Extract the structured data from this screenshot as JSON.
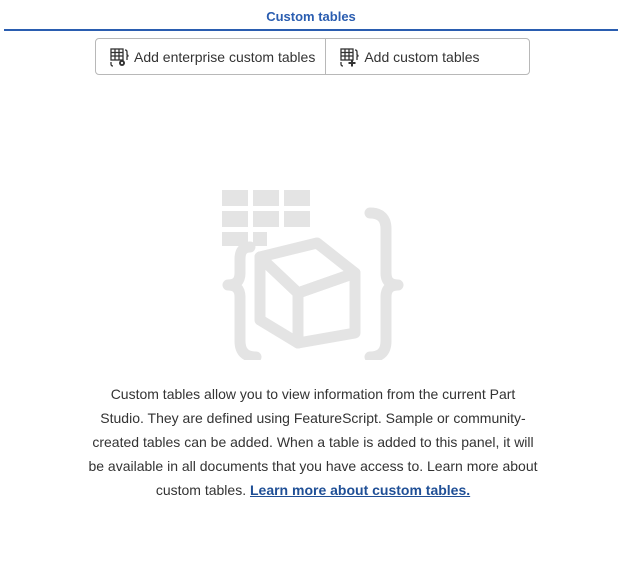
{
  "header": {
    "title": "Custom tables"
  },
  "toolbar": {
    "add_enterprise_label": "Add enterprise custom tables",
    "add_custom_label": "Add custom tables"
  },
  "empty_state": {
    "description": "Custom tables allow you to view information from the current Part Studio. They are defined using FeatureScript. Sample or community-created tables can be added. When a table is added to this panel, it will be available in all documents that you have access to. Learn more about custom tables. ",
    "link_text": "Learn more about custom tables."
  },
  "colors": {
    "accent": "#2a5db0",
    "link": "#1f4f96",
    "illustration": "#e4e4e4"
  }
}
